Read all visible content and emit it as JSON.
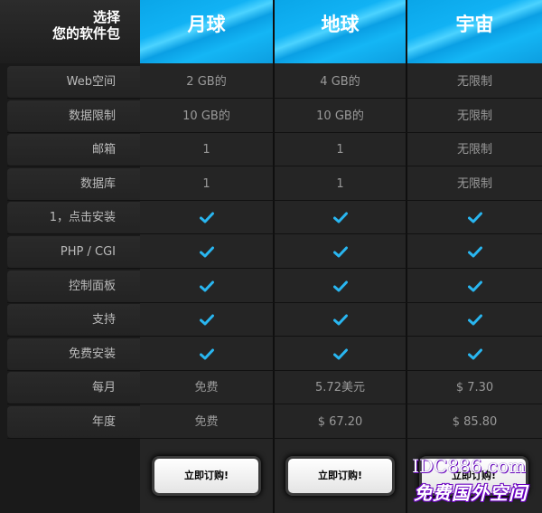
{
  "header": {
    "title_line1": "选择",
    "title_line2": "您的软件包"
  },
  "plans": [
    {
      "name": "月球",
      "order_button": "立即订购!"
    },
    {
      "name": "地球",
      "order_button": "立即订购!"
    },
    {
      "name": "宇宙",
      "order_button": "立即订购!"
    }
  ],
  "rows": [
    {
      "label": "Web空间",
      "values": [
        "2 GB的",
        "4 GB的",
        "无限制"
      ]
    },
    {
      "label": "数据限制",
      "values": [
        "10 GB的",
        "10 GB的",
        "无限制"
      ]
    },
    {
      "label": "邮箱",
      "values": [
        "1",
        "1",
        "无限制"
      ]
    },
    {
      "label": "数据库",
      "values": [
        "1",
        "1",
        "无限制"
      ]
    },
    {
      "label": "1，点击安装",
      "values": [
        "check",
        "check",
        "check"
      ]
    },
    {
      "label": "PHP / CGI",
      "values": [
        "check",
        "check",
        "check"
      ]
    },
    {
      "label": "控制面板",
      "values": [
        "check",
        "check",
        "check"
      ]
    },
    {
      "label": "支持",
      "values": [
        "check",
        "check",
        "check"
      ]
    },
    {
      "label": "免费安装",
      "values": [
        "check",
        "check",
        "check"
      ]
    },
    {
      "label": "每月",
      "values": [
        "免费",
        "5.72美元",
        "$ 7.30"
      ]
    },
    {
      "label": "年度",
      "values": [
        "免费",
        "$ 67.20",
        "$ 85.80"
      ]
    }
  ],
  "check_icon": "checkmark-icon",
  "check_color": "#29b6f0",
  "watermark": {
    "line1": "IDC886.com",
    "line2": "免费国外空间"
  }
}
